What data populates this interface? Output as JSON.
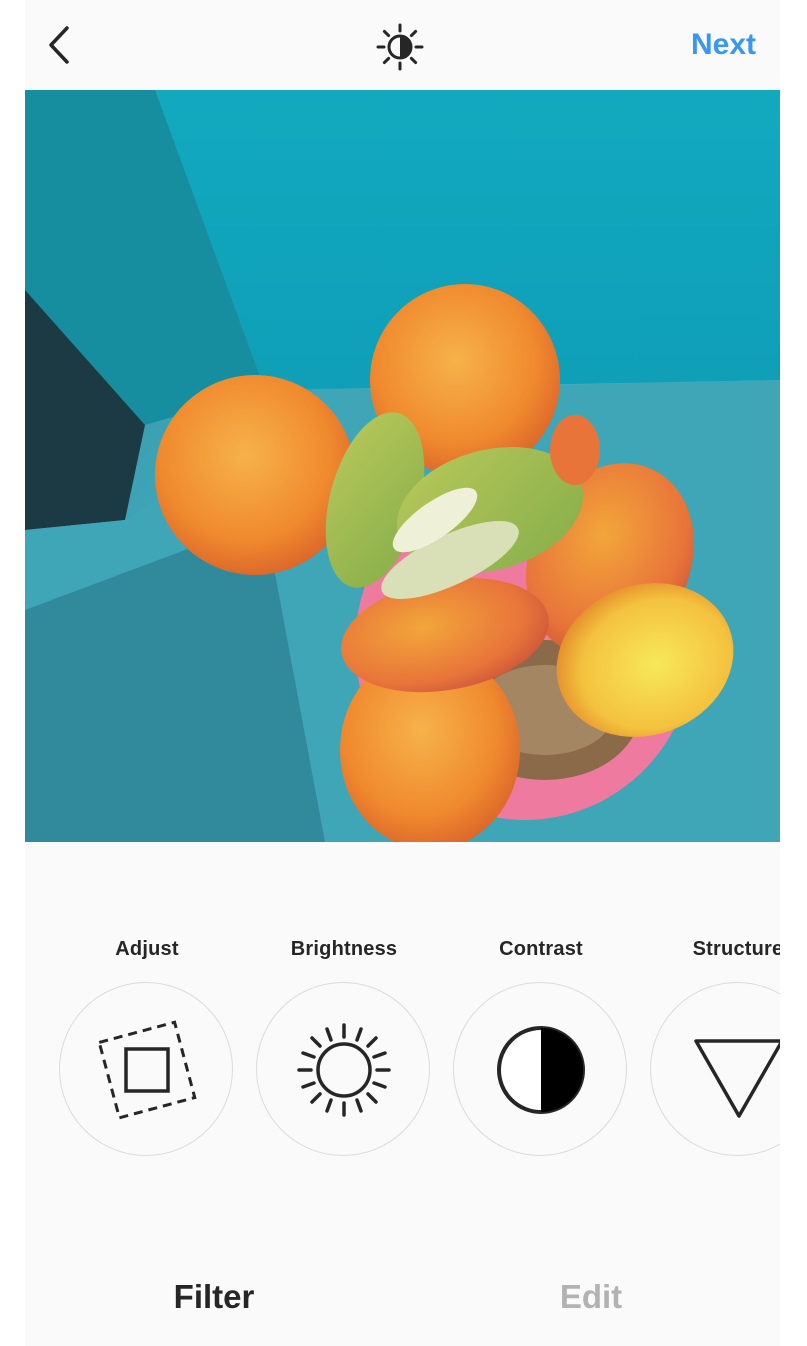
{
  "header": {
    "back_icon": "chevron-left-icon",
    "center_icon": "lux-icon",
    "next_label": "Next"
  },
  "photo": {
    "subject": "succulent-photo"
  },
  "tools": [
    {
      "label": "Adjust",
      "icon": "adjust-icon"
    },
    {
      "label": "Brightness",
      "icon": "brightness-icon"
    },
    {
      "label": "Contrast",
      "icon": "contrast-icon"
    },
    {
      "label": "Structure",
      "icon": "structure-icon"
    }
  ],
  "tabs": {
    "filter_label": "Filter",
    "edit_label": "Edit"
  },
  "colors": {
    "accent": "#3897f0",
    "text": "#262626",
    "inactive": "#b2b2b2"
  }
}
